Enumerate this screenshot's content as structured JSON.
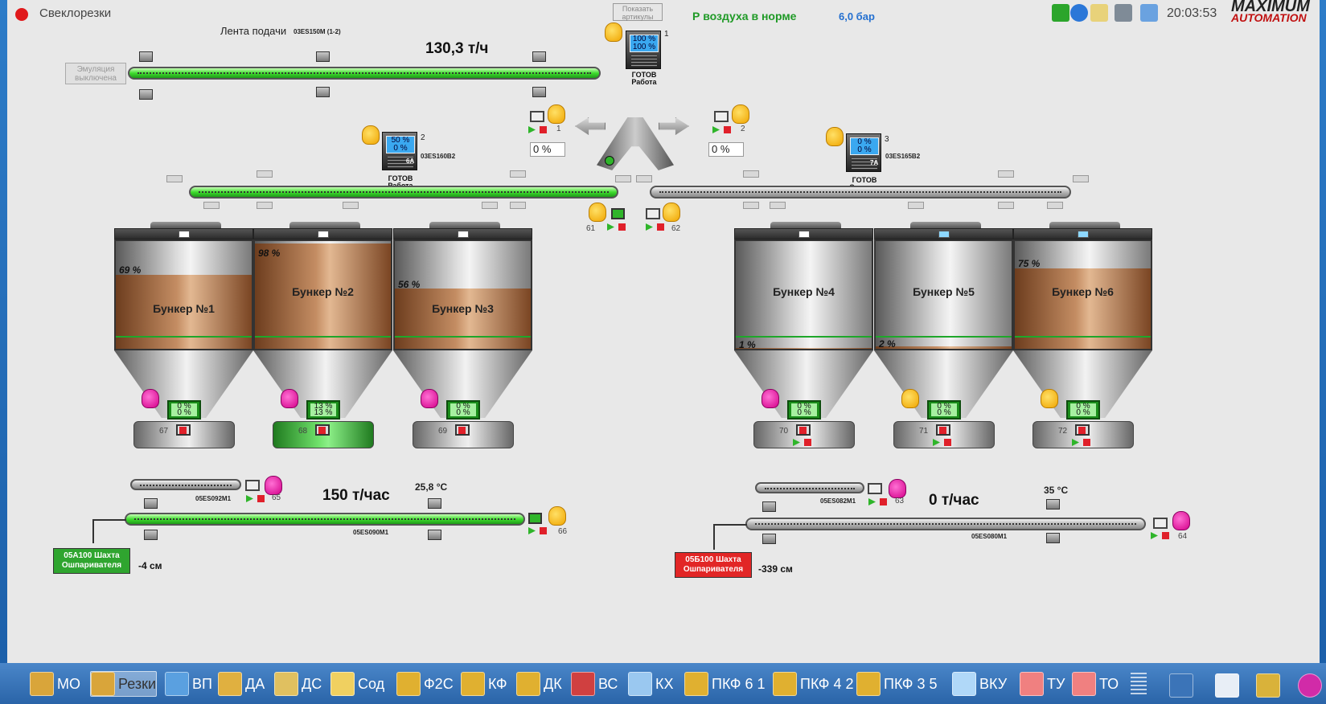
{
  "window": {
    "title": "Свеклорезки",
    "show_articles_button": "Показать артикулы"
  },
  "status": {
    "air_pressure_text": "Р воздуха в норме",
    "pressure_value": "6,0 бар",
    "clock": "20:03:53"
  },
  "logo": {
    "text1": "MAXIMUM",
    "text2": "AUTOMATION"
  },
  "feed_conveyor": {
    "label": "Лента подачи",
    "code": "03ES150M (1-2)",
    "rate": "130,3 т/ч",
    "emulation": "Эмуляция выключена"
  },
  "drive1": {
    "num": "1",
    "top": "100 %",
    "bottom": "100 %",
    "state": "ГОТОВ",
    "mode": "Работа"
  },
  "drive2": {
    "num": "2",
    "top": "50 %",
    "bottom": "0 %",
    "id": "6A",
    "code": "03ES160B2",
    "state": "ГОТОВ",
    "mode": "Работа"
  },
  "drive3": {
    "num": "3",
    "top": "0 %",
    "bottom": "0 %",
    "id": "7A",
    "code": "03ES165B2",
    "state": "ГОТОВ",
    "mode": "Останов"
  },
  "splitter": {
    "left_num": "1",
    "right_num": "2",
    "left_pct": "0 %",
    "right_pct": "0 %"
  },
  "dist_labels": {
    "left": "61",
    "right": "62"
  },
  "bunkers": [
    {
      "name": "Бункер №1",
      "pct": "69 %",
      "fill": 0.69,
      "feeder": "67",
      "top": "0 %",
      "bottom": "0 %"
    },
    {
      "name": "Бункер №2",
      "pct": "98 %",
      "fill": 0.98,
      "feeder": "68",
      "top": "13 %",
      "bottom": "13 %"
    },
    {
      "name": "Бункер №3",
      "pct": "56 %",
      "fill": 0.56,
      "feeder": "69",
      "top": "0 %",
      "bottom": "0 %"
    },
    {
      "name": "Бункер №4",
      "pct": "1 %",
      "fill": 0.01,
      "feeder": "70",
      "top": "0 %",
      "bottom": "0 %"
    },
    {
      "name": "Бункер №5",
      "pct": "2 %",
      "fill": 0.02,
      "feeder": "71",
      "top": "0 %",
      "bottom": "0 %"
    },
    {
      "name": "Бункер №6",
      "pct": "75 %",
      "fill": 0.75,
      "feeder": "72",
      "top": "0 %",
      "bottom": "0 %"
    }
  ],
  "left_line": {
    "small_code": "05ES092M1",
    "small_num": "65",
    "rate": "150 т/час",
    "temp": "25,8 °C",
    "code": "05ES090M1",
    "num": "66",
    "shaft": "05А100 Шахта Ошпаривателя",
    "level": "-4 см"
  },
  "right_line": {
    "small_code": "05ES082M1",
    "small_num": "63",
    "rate": "0 т/час",
    "temp": "35 °C",
    "code": "05ES080M1",
    "num": "64",
    "shaft": "05Б100 Шахта Ошпаривателя",
    "level": "-339 см"
  },
  "taskbar": [
    {
      "label": "МО"
    },
    {
      "label": "Резки"
    },
    {
      "label": "ВП"
    },
    {
      "label": "ДА"
    },
    {
      "label": "ДС"
    },
    {
      "label": "Сод"
    },
    {
      "label": "Ф2С"
    },
    {
      "label": "КФ"
    },
    {
      "label": "ДК"
    },
    {
      "label": "ВС"
    },
    {
      "label": "КХ"
    },
    {
      "label": "ПКФ 6 1"
    },
    {
      "label": "ПКФ 4 2"
    },
    {
      "label": "ПКФ 3 5"
    },
    {
      "label": "ВКУ"
    },
    {
      "label": "ТУ"
    },
    {
      "label": "ТО"
    }
  ]
}
